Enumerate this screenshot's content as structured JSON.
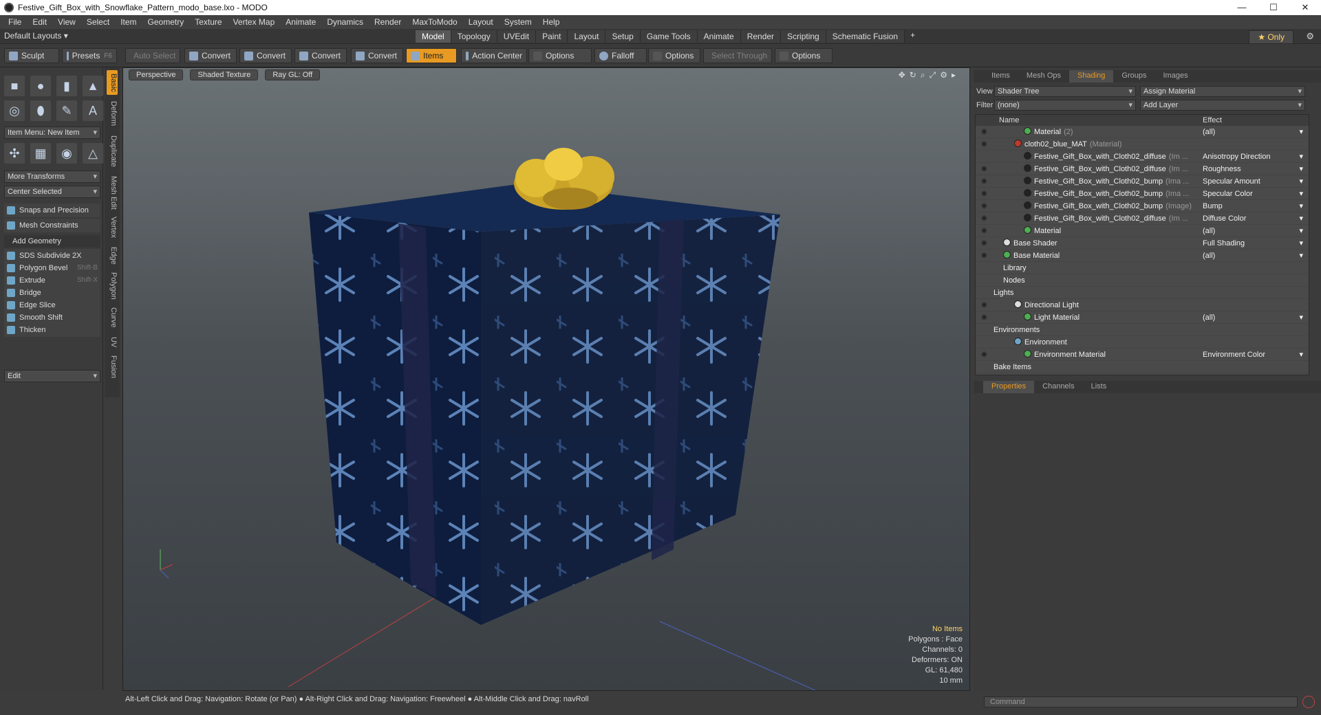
{
  "window": {
    "title": "Festive_Gift_Box_with_Snowflake_Pattern_modo_base.lxo - MODO",
    "buttons": [
      "—",
      "☐",
      "✕"
    ]
  },
  "menu": [
    "File",
    "Edit",
    "View",
    "Select",
    "Item",
    "Geometry",
    "Texture",
    "Vertex Map",
    "Animate",
    "Dynamics",
    "Render",
    "MaxToModo",
    "Layout",
    "System",
    "Help"
  ],
  "layouts": {
    "label": "Default Layouts ▾"
  },
  "main_tabs": [
    {
      "label": "Model",
      "active": true
    },
    {
      "label": "Topology"
    },
    {
      "label": "UVEdit"
    },
    {
      "label": "Paint"
    },
    {
      "label": "Layout"
    },
    {
      "label": "Setup"
    },
    {
      "label": "Game Tools"
    },
    {
      "label": "Animate"
    },
    {
      "label": "Render"
    },
    {
      "label": "Scripting"
    },
    {
      "label": "Schematic Fusion"
    }
  ],
  "only_label": "★  Only",
  "toolbar": {
    "sculpt": "Sculpt",
    "presets": "Presets",
    "presets_key": "F6",
    "auto_select": "Auto Select",
    "convert": "Convert",
    "items": "Items",
    "action_center": "Action Center",
    "options": "Options",
    "falloff": "Falloff",
    "select_through": "Select Through"
  },
  "left": {
    "item_menu": "Item Menu: New Item",
    "more_transforms": "More Transforms",
    "center_selected": "Center Selected",
    "snaps": "Snaps and Precision",
    "mesh_constraints": "Mesh Constraints",
    "add_geometry": "Add Geometry",
    "tools": [
      {
        "label": "SDS Subdivide 2X",
        "key": ""
      },
      {
        "label": "Polygon Bevel",
        "key": "Shift-B"
      },
      {
        "label": "Extrude",
        "key": "Shift-X"
      },
      {
        "label": "Bridge",
        "key": ""
      },
      {
        "label": "Edge Slice",
        "key": ""
      },
      {
        "label": "Smooth Shift",
        "key": ""
      },
      {
        "label": "Thicken",
        "key": ""
      }
    ],
    "edit": "Edit",
    "vtabs": [
      "Basic",
      "Deform",
      "Duplicate",
      "Mesh Edit",
      "Vertex",
      "Edge",
      "Polygon",
      "Curve",
      "UV",
      "Fusion"
    ]
  },
  "viewport": {
    "view": "Perspective",
    "shading": "Shaded Texture",
    "raygl": "Ray GL: Off",
    "stats": [
      "No Items",
      "Polygons : Face",
      "Channels: 0",
      "Deformers: ON",
      "GL: 61,480",
      "10 mm"
    ]
  },
  "right": {
    "tabs": [
      "Items",
      "Mesh Ops",
      "Shading",
      "Groups",
      "Images"
    ],
    "active_tab": "Shading",
    "view_label": "View",
    "view_value": "Shader Tree",
    "assign": "Assign Material",
    "filter_label": "Filter",
    "filter_value": "(none)",
    "add_layer": "Add Layer",
    "col_name": "Name",
    "col_effect": "Effect",
    "rows": [
      {
        "name": "Material",
        "sub": "(2)",
        "effect": "(all)",
        "indent": 70,
        "color": "#4caf50",
        "eye": true,
        "drop": true
      },
      {
        "name": "cloth02_blue_MAT",
        "sub": "(Material)",
        "effect": "",
        "indent": 56,
        "color": "#c0392b",
        "eye": true,
        "drop": false
      },
      {
        "name": "Festive_Gift_Box_with_Cloth02_diffuse",
        "sub": "(Im ...",
        "effect": "Anisotropy Direction",
        "indent": 70,
        "color": "#222",
        "eye": false,
        "drop": true
      },
      {
        "name": "Festive_Gift_Box_with_Cloth02_diffuse",
        "sub": "(Im ...",
        "effect": "Roughness",
        "indent": 70,
        "color": "#222",
        "eye": true,
        "drop": true
      },
      {
        "name": "Festive_Gift_Box_with_Cloth02_bump",
        "sub": "(Ima ...",
        "effect": "Specular Amount",
        "indent": 70,
        "color": "#222",
        "eye": true,
        "drop": true
      },
      {
        "name": "Festive_Gift_Box_with_Cloth02_bump",
        "sub": "(Ima ...",
        "effect": "Specular Color",
        "indent": 70,
        "color": "#222",
        "eye": true,
        "drop": true
      },
      {
        "name": "Festive_Gift_Box_with_Cloth02_bump",
        "sub": "(Image)",
        "effect": "Bump",
        "indent": 70,
        "color": "#222",
        "eye": true,
        "drop": true
      },
      {
        "name": "Festive_Gift_Box_with_Cloth02_diffuse",
        "sub": "(Im ...",
        "effect": "Diffuse Color",
        "indent": 70,
        "color": "#222",
        "eye": true,
        "drop": true
      },
      {
        "name": "Material",
        "sub": "",
        "effect": "(all)",
        "indent": 70,
        "color": "#4caf50",
        "eye": true,
        "drop": true
      },
      {
        "name": "Base Shader",
        "sub": "",
        "effect": "Full Shading",
        "indent": 40,
        "color": "#ddd",
        "eye": true,
        "drop": true
      },
      {
        "name": "Base Material",
        "sub": "",
        "effect": "(all)",
        "indent": 40,
        "color": "#4caf50",
        "eye": true,
        "drop": true
      },
      {
        "name": "Library",
        "sub": "",
        "effect": "",
        "indent": 40,
        "color": "",
        "eye": false,
        "drop": false
      },
      {
        "name": "Nodes",
        "sub": "",
        "effect": "",
        "indent": 40,
        "color": "",
        "eye": false,
        "drop": false
      },
      {
        "name": "Lights",
        "sub": "",
        "effect": "",
        "indent": 26,
        "color": "",
        "eye": false,
        "drop": false
      },
      {
        "name": "Directional Light",
        "sub": "",
        "effect": "",
        "indent": 56,
        "color": "#ddd",
        "eye": true,
        "drop": false
      },
      {
        "name": "Light Material",
        "sub": "",
        "effect": "(all)",
        "indent": 70,
        "color": "#4caf50",
        "eye": true,
        "drop": true
      },
      {
        "name": "Environments",
        "sub": "",
        "effect": "",
        "indent": 26,
        "color": "",
        "eye": false,
        "drop": false
      },
      {
        "name": "Environment",
        "sub": "",
        "effect": "",
        "indent": 56,
        "color": "#6fa6c8",
        "eye": false,
        "drop": false
      },
      {
        "name": "Environment Material",
        "sub": "",
        "effect": "Environment Color",
        "indent": 70,
        "color": "#4caf50",
        "eye": true,
        "drop": true
      },
      {
        "name": "Bake Items",
        "sub": "",
        "effect": "",
        "indent": 26,
        "color": "",
        "eye": false,
        "drop": false
      }
    ],
    "bottom_tabs": [
      "Properties",
      "Channels",
      "Lists"
    ]
  },
  "status": "Alt-Left Click and Drag: Navigation: Rotate (or Pan) ● Alt-Right Click and Drag: Navigation: Freewheel ● Alt-Middle Click and Drag: navRoll",
  "command_placeholder": "Command"
}
